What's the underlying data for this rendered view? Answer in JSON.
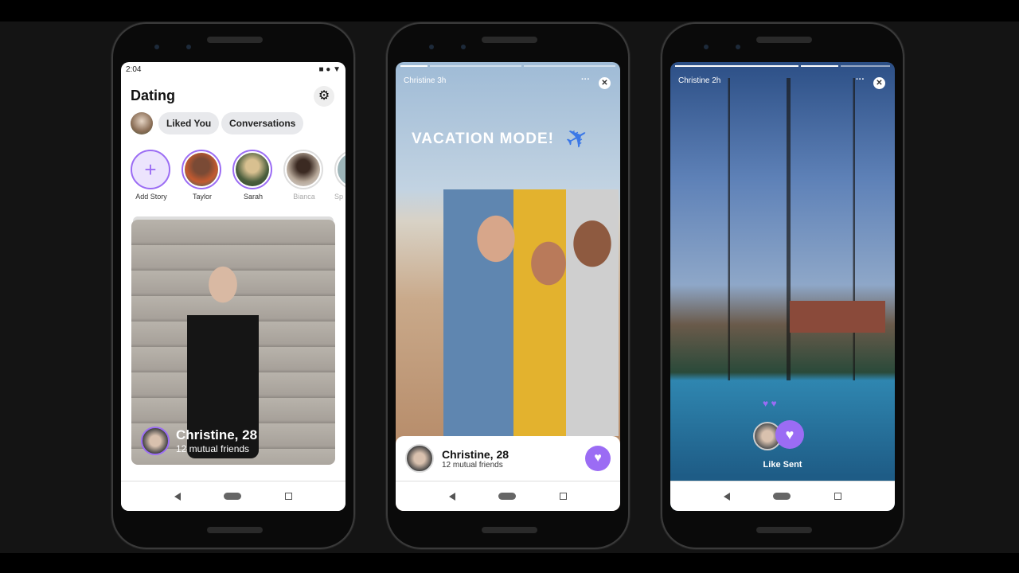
{
  "colors": {
    "accent": "#9b6cf4"
  },
  "phone1": {
    "status_time": "2:04",
    "title": "Dating",
    "settings_icon": "gear-icon",
    "pills": [
      "Liked You",
      "Conversations"
    ],
    "stories": [
      {
        "label": "Add Story"
      },
      {
        "label": "Taylor"
      },
      {
        "label": "Sarah"
      },
      {
        "label": "Bianca"
      },
      {
        "label": "Sp"
      }
    ],
    "card": {
      "name": "Christine, 28",
      "mutual": "12 mutual friends"
    }
  },
  "phone2": {
    "header": "Christine 3h",
    "more": "···",
    "overlay_text": "VACATION MODE!",
    "name": "Christine, 28",
    "mutual": "12 mutual friends"
  },
  "phone3": {
    "header": "Christine 2h",
    "more": "···",
    "like_sent": "Like Sent"
  }
}
